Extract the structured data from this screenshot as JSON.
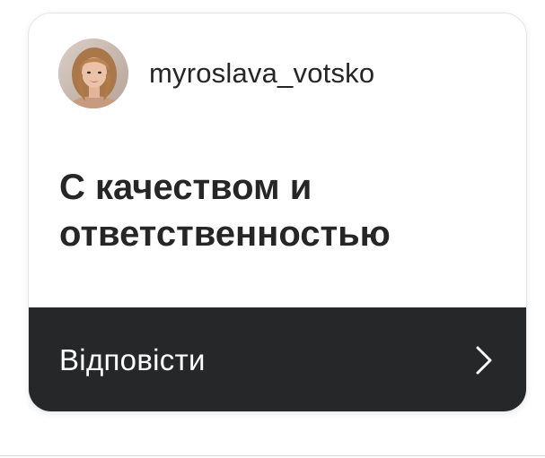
{
  "story_reply": {
    "username": "myroslava_votsko",
    "message": "С качеством и ответственностью",
    "reply_label": "Відповісти",
    "icons": {
      "avatar": "profile-photo",
      "chevron": "chevron-right-icon"
    },
    "colors": {
      "card_background": "#ffffff",
      "reply_bar_background": "#262729",
      "text_primary": "#262626",
      "reply_text": "#ffffff"
    }
  }
}
